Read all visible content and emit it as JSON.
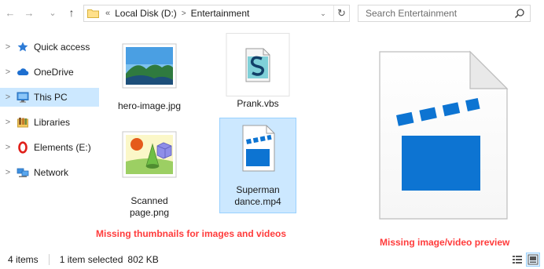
{
  "window": {
    "title": "Entertainment"
  },
  "address_bar": {
    "overflow_chevron": "«",
    "breadcrumbs": [
      "Local Disk (D:)",
      "Entertainment"
    ],
    "separator": ">"
  },
  "search": {
    "placeholder": "Search Entertainment"
  },
  "nav_buttons": {
    "back": "←",
    "forward": "→",
    "recent": "⌄",
    "up": "↑"
  },
  "navigation_pane": {
    "items": [
      {
        "label": "Quick access",
        "icon": "star-icon",
        "chevron": ">"
      },
      {
        "label": "OneDrive",
        "icon": "cloud-icon",
        "chevron": ">"
      },
      {
        "label": "This PC",
        "icon": "monitor-icon",
        "chevron": ">",
        "selected": true
      },
      {
        "label": "Libraries",
        "icon": "libraries-icon",
        "chevron": ">"
      },
      {
        "label": "Elements (E:)",
        "icon": "drive-o-icon",
        "chevron": ">"
      },
      {
        "label": "Network",
        "icon": "network-icon",
        "chevron": ">"
      }
    ]
  },
  "files": [
    {
      "name": "hero-image.jpg",
      "icon": "landscape-image-icon"
    },
    {
      "name": "Prank.vbs",
      "icon": "vbscript-icon"
    },
    {
      "name": "Scanned\npage.png",
      "icon": "shapes-image-icon"
    },
    {
      "name": "Superman\ndance.mp4",
      "icon": "video-clapper-icon",
      "selected": true
    }
  ],
  "annotations": {
    "thumbnails": "Missing thumbnails for images and videos",
    "preview": "Missing image/video preview"
  },
  "status_bar": {
    "item_count": "4 items",
    "selection": "1 item selected",
    "size": "802 KB"
  },
  "colors": {
    "selection_bg": "#cce8ff",
    "selection_border": "#99d1ff",
    "annotation": "#ff3b3b",
    "clapper_blue": "#0d74d2"
  }
}
